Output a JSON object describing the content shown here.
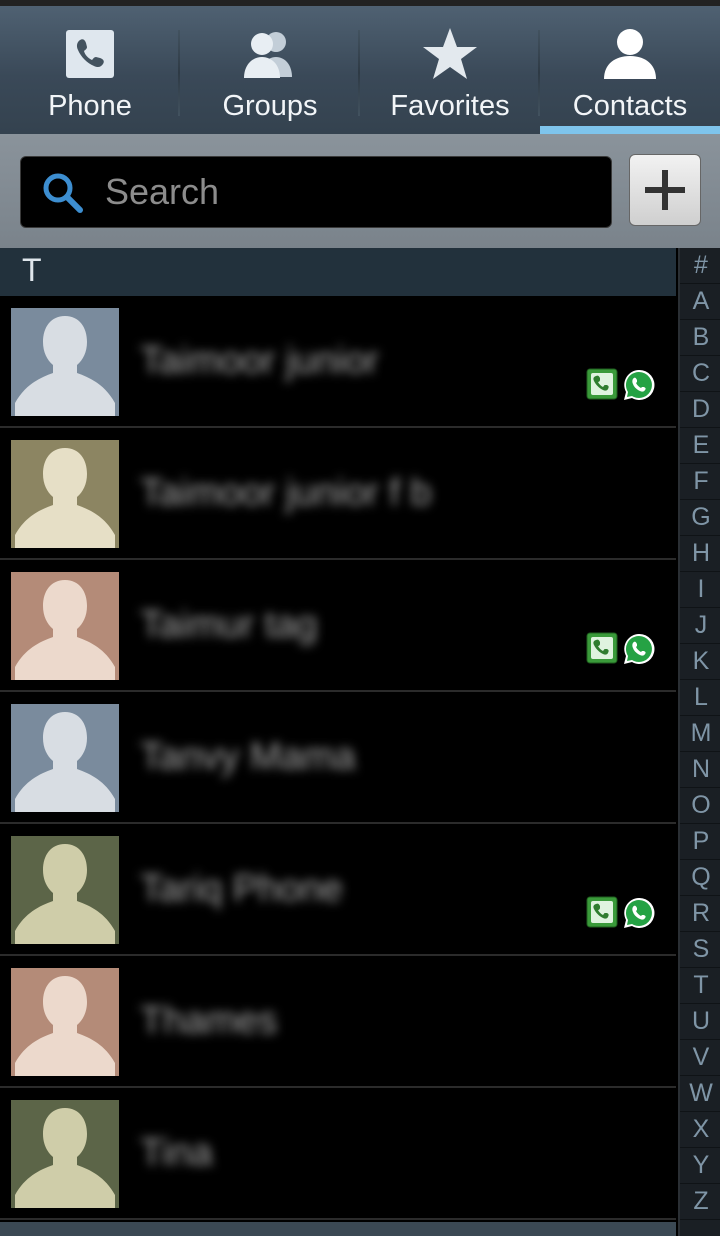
{
  "tabs": [
    {
      "label": "Phone",
      "icon": "phone-icon",
      "active": false
    },
    {
      "label": "Groups",
      "icon": "groups-icon",
      "active": false
    },
    {
      "label": "Favorites",
      "icon": "star-icon",
      "active": false
    },
    {
      "label": "Contacts",
      "icon": "contact-icon",
      "active": true
    }
  ],
  "search": {
    "placeholder": "Search",
    "value": ""
  },
  "add_button": {
    "icon": "plus-icon"
  },
  "section_header": "T",
  "contacts": [
    {
      "name": "Taimoor junior",
      "avatar_bg": "#7a8b9d",
      "avatar_fg": "#d8dde3",
      "badges": true
    },
    {
      "name": "Taimoor junior f b",
      "avatar_bg": "#8c8562",
      "avatar_fg": "#e6dfc6",
      "badges": false
    },
    {
      "name": "Taimur tag",
      "avatar_bg": "#b48b78",
      "avatar_fg": "#ecd9cc",
      "badges": true
    },
    {
      "name": "Tanvy Mama",
      "avatar_bg": "#7a8b9d",
      "avatar_fg": "#d8dde3",
      "badges": false
    },
    {
      "name": "Tariq Phone",
      "avatar_bg": "#5c6548",
      "avatar_fg": "#cfcda9",
      "badges": true
    },
    {
      "name": "Thames",
      "avatar_bg": "#b48b78",
      "avatar_fg": "#ecd9cc",
      "badges": false
    },
    {
      "name": "Tina",
      "avatar_bg": "#5c6548",
      "avatar_fg": "#cfcda9",
      "badges": false
    }
  ],
  "alphabet": [
    "#",
    "A",
    "B",
    "C",
    "D",
    "E",
    "F",
    "G",
    "H",
    "I",
    "J",
    "K",
    "L",
    "M",
    "N",
    "O",
    "P",
    "Q",
    "R",
    "S",
    "T",
    "U",
    "V",
    "W",
    "X",
    "Y",
    "Z"
  ],
  "colors": {
    "accent": "#7ec4ec",
    "phone_badge": "#3a9a3a",
    "whatsapp_badge": "#25a244"
  }
}
